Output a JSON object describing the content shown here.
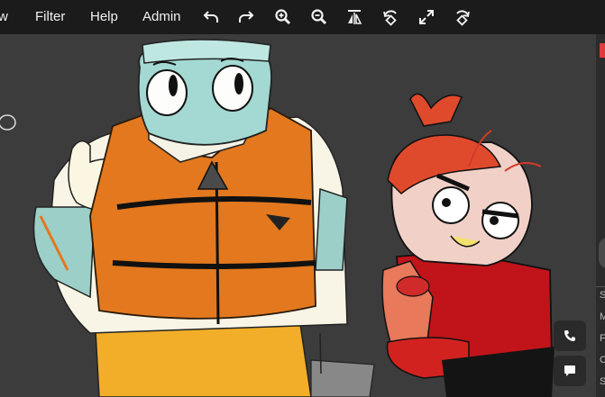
{
  "menubar": {
    "items": [
      {
        "label": "w"
      },
      {
        "label": "Filter"
      },
      {
        "label": "Help"
      },
      {
        "label": "Admin"
      }
    ],
    "tools": [
      "undo-icon",
      "redo-icon",
      "zoom-in-icon",
      "zoom-out-icon",
      "flip-icon",
      "rotate-left-icon",
      "fullscreen-icon",
      "rotate-right-icon"
    ]
  },
  "right_panel": {
    "letters": [
      "S",
      "M",
      "F",
      "C",
      "S"
    ]
  },
  "fabs": [
    "phone-icon",
    "chat-icon"
  ],
  "colors": {
    "menubar_bg": "#1b1b1b",
    "canvas_bg": "#3c3c3c",
    "vest_orange": "#e3781e",
    "shirt_red": "#c0141a"
  }
}
